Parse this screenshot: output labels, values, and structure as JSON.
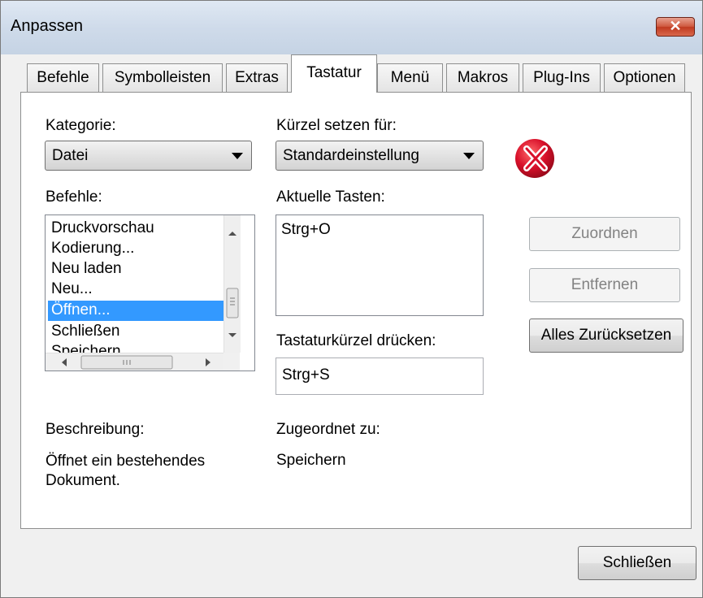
{
  "window": {
    "title": "Anpassen",
    "close_glyph": "✕"
  },
  "tabs": [
    {
      "label": "Befehle"
    },
    {
      "label": "Symbolleisten"
    },
    {
      "label": "Extras"
    },
    {
      "label": "Tastatur",
      "active": true
    },
    {
      "label": "Menü"
    },
    {
      "label": "Makros"
    },
    {
      "label": "Plug-Ins"
    },
    {
      "label": "Optionen"
    }
  ],
  "keyboard": {
    "category_label": "Kategorie:",
    "category_value": "Datei",
    "set_for_label": "Kürzel setzen für:",
    "set_for_value": "Standardeinstellung",
    "commands_label": "Befehle:",
    "commands": [
      "Druckvorschau",
      "Kodierung...",
      "Neu laden",
      "Neu...",
      "Öffnen...",
      "Schließen",
      "Speichern"
    ],
    "selected_command": "Öffnen...",
    "current_keys_label": "Aktuelle Tasten:",
    "current_keys": [
      "Strg+O"
    ],
    "press_shortcut_label": "Tastaturkürzel drücken:",
    "press_shortcut_value": "Strg+S",
    "description_label": "Beschreibung:",
    "description_text": "Öffnet ein bestehendes Dokument.",
    "assigned_to_label": "Zugeordnet zu:",
    "assigned_to_value": "Speichern",
    "assign_button": "Zuordnen",
    "remove_button": "Entfernen",
    "reset_all_button": "Alles Zurücksetzen",
    "assign_enabled": false,
    "remove_enabled": false
  },
  "footer": {
    "close_button": "Schließen"
  },
  "colors": {
    "selection": "#3399ff",
    "logo_red": "#d8102a",
    "close_red": "#c8462c"
  },
  "icons": {
    "logo": "xmlspy-logo-icon",
    "close": "close-icon"
  }
}
